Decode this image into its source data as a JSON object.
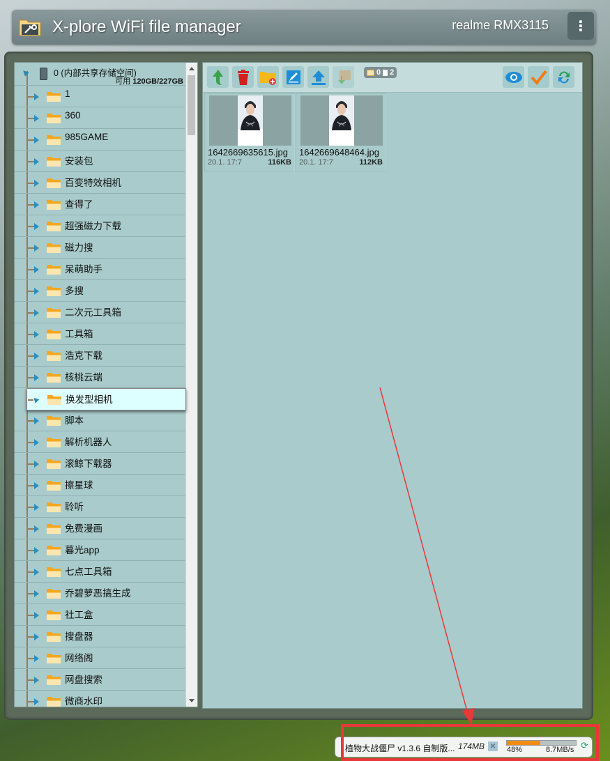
{
  "header": {
    "title": "X-plore WiFi file manager",
    "device": "realme RMX3115",
    "menu_icon": "⋮"
  },
  "tree": {
    "root": {
      "label": "0 (内部共享存储空间)",
      "free_prefix": "可用",
      "free_value": "120GB/227GB"
    },
    "items": [
      {
        "label": "1"
      },
      {
        "label": "360"
      },
      {
        "label": "985GAME"
      },
      {
        "label": "安装包"
      },
      {
        "label": "百变特效相机"
      },
      {
        "label": "查得了"
      },
      {
        "label": "超强磁力下载"
      },
      {
        "label": "磁力搜"
      },
      {
        "label": "呆萌助手"
      },
      {
        "label": "多搜"
      },
      {
        "label": "二次元工具箱"
      },
      {
        "label": "工具箱"
      },
      {
        "label": "浩克下载"
      },
      {
        "label": "核桃云端"
      },
      {
        "label": "换发型相机",
        "selected": true
      },
      {
        "label": "脚本"
      },
      {
        "label": "解析机器人"
      },
      {
        "label": "滚鲸下载器"
      },
      {
        "label": "擦星球"
      },
      {
        "label": "聆听"
      },
      {
        "label": "免费漫画"
      },
      {
        "label": "暮光app"
      },
      {
        "label": "七点工具箱"
      },
      {
        "label": "乔碧萝恶搞生成"
      },
      {
        "label": "社工盒"
      },
      {
        "label": "搜盘器"
      },
      {
        "label": "网络阁"
      },
      {
        "label": "网盘搜索"
      },
      {
        "label": "微商水印"
      }
    ]
  },
  "toolbar": {
    "buttons": [
      "up-icon",
      "delete-icon",
      "new-folder-icon",
      "rename-icon",
      "upload-icon",
      "download-icon"
    ],
    "right_buttons": [
      "view-icon",
      "select-icon",
      "refresh-icon"
    ],
    "folder_count": "0",
    "file_count": "2"
  },
  "files": [
    {
      "name": "1642669635615.jpg",
      "date": "20.1. 17:7",
      "size": "116KB"
    },
    {
      "name": "1642669648464.jpg",
      "date": "20.1. 17:7",
      "size": "112KB"
    }
  ],
  "status": {
    "name": "植物大战僵尸 v1.3.6 自制版...",
    "size": "174MB",
    "percent": "48%",
    "progress": 0.48,
    "speed": "8.7MB/s"
  },
  "colors": {
    "panel_bg": "#a9cbcb",
    "selected_bg": "#ddffff",
    "progress_fill": "#f28c11",
    "annotation": "#e8383a"
  }
}
